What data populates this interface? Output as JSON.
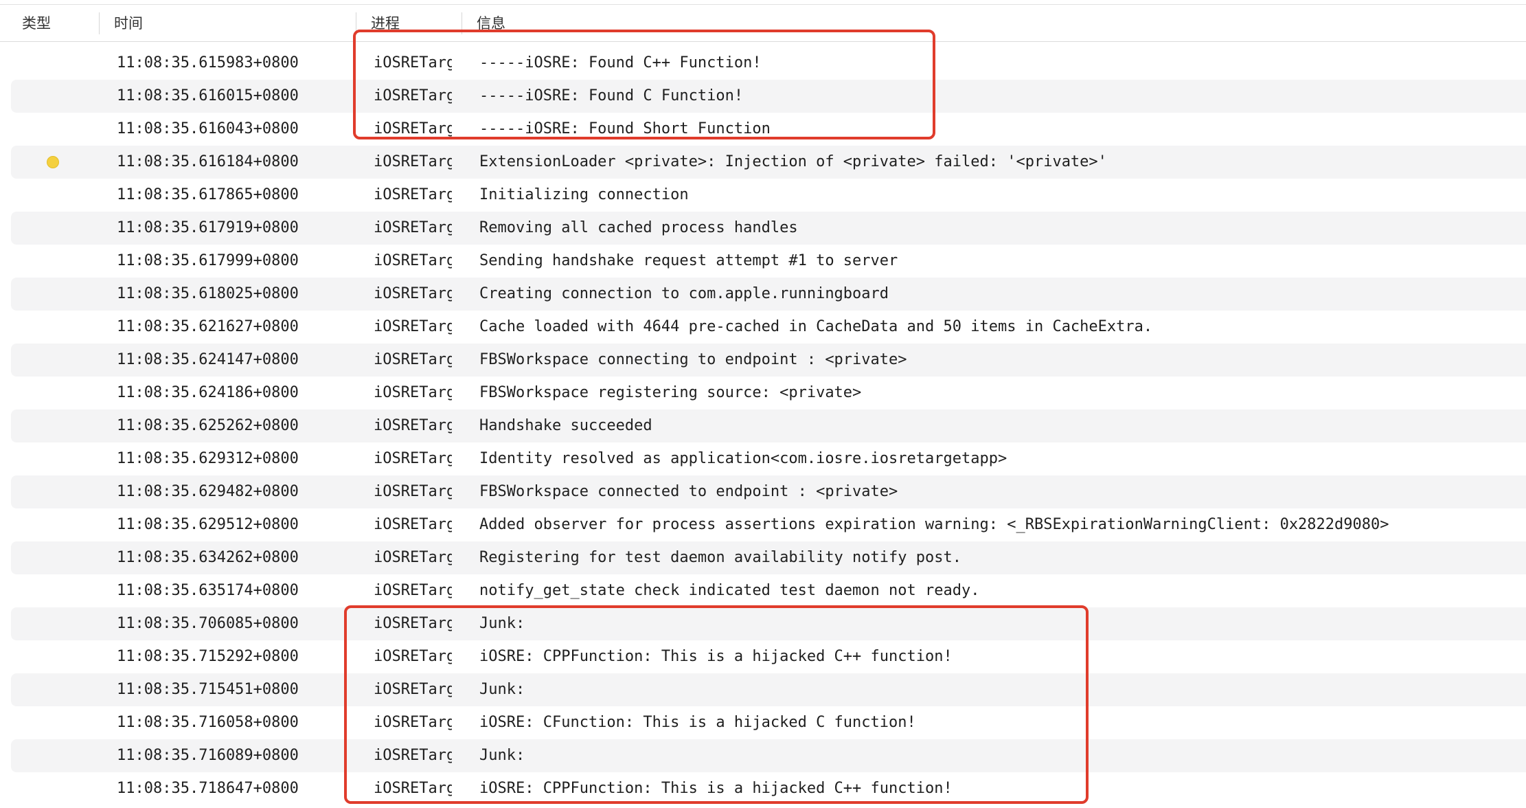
{
  "columns": {
    "type": "类型",
    "time": "时间",
    "process": "进程",
    "message": "信息"
  },
  "rows": [
    {
      "type": "",
      "time": "11:08:35.615983+0800",
      "process": "iOSRETargetApp",
      "message": "-----iOSRE: Found C++ Function!"
    },
    {
      "type": "",
      "time": "11:08:35.616015+0800",
      "process": "iOSRETargetApp",
      "message": "-----iOSRE: Found C Function!"
    },
    {
      "type": "",
      "time": "11:08:35.616043+0800",
      "process": "iOSRETargetApp",
      "message": "-----iOSRE: Found Short Function"
    },
    {
      "type": "warning-dot",
      "time": "11:08:35.616184+0800",
      "process": "iOSRETargetApp",
      "message": "ExtensionLoader <private>: Injection of <private> failed: '<private>'"
    },
    {
      "type": "",
      "time": "11:08:35.617865+0800",
      "process": "iOSRETargetApp",
      "message": "Initializing connection"
    },
    {
      "type": "",
      "time": "11:08:35.617919+0800",
      "process": "iOSRETargetApp",
      "message": "Removing all cached process handles"
    },
    {
      "type": "",
      "time": "11:08:35.617999+0800",
      "process": "iOSRETargetApp",
      "message": "Sending handshake request attempt #1 to server"
    },
    {
      "type": "",
      "time": "11:08:35.618025+0800",
      "process": "iOSRETargetApp",
      "message": "Creating connection to com.apple.runningboard"
    },
    {
      "type": "",
      "time": "11:08:35.621627+0800",
      "process": "iOSRETargetApp",
      "message": "Cache loaded with 4644 pre-cached in CacheData and 50 items in CacheExtra."
    },
    {
      "type": "",
      "time": "11:08:35.624147+0800",
      "process": "iOSRETargetApp",
      "message": "FBSWorkspace connecting to endpoint : <private>"
    },
    {
      "type": "",
      "time": "11:08:35.624186+0800",
      "process": "iOSRETargetApp",
      "message": "FBSWorkspace registering source: <private>"
    },
    {
      "type": "",
      "time": "11:08:35.625262+0800",
      "process": "iOSRETargetApp",
      "message": "Handshake succeeded"
    },
    {
      "type": "",
      "time": "11:08:35.629312+0800",
      "process": "iOSRETargetApp",
      "message": "Identity resolved as application<com.iosre.iosretargetapp>"
    },
    {
      "type": "",
      "time": "11:08:35.629482+0800",
      "process": "iOSRETargetApp",
      "message": "FBSWorkspace connected to endpoint : <private>"
    },
    {
      "type": "",
      "time": "11:08:35.629512+0800",
      "process": "iOSRETargetApp",
      "message": "Added observer for process assertions expiration warning: <_RBSExpirationWarningClient: 0x2822d9080>"
    },
    {
      "type": "",
      "time": "11:08:35.634262+0800",
      "process": "iOSRETargetApp",
      "message": "Registering for test daemon availability notify post."
    },
    {
      "type": "",
      "time": "11:08:35.635174+0800",
      "process": "iOSRETargetApp",
      "message": "notify_get_state check indicated test daemon not ready."
    },
    {
      "type": "",
      "time": "11:08:35.706085+0800",
      "process": "iOSRETargetApp",
      "message": "Junk:"
    },
    {
      "type": "",
      "time": "11:08:35.715292+0800",
      "process": "iOSRETargetApp",
      "message": "iOSRE: CPPFunction: This is a hijacked C++ function!"
    },
    {
      "type": "",
      "time": "11:08:35.715451+0800",
      "process": "iOSRETargetApp",
      "message": "Junk:"
    },
    {
      "type": "",
      "time": "11:08:35.716058+0800",
      "process": "iOSRETargetApp",
      "message": "iOSRE: CFunction: This is a hijacked C function!"
    },
    {
      "type": "",
      "time": "11:08:35.716089+0800",
      "process": "iOSRETargetApp",
      "message": "Junk:"
    },
    {
      "type": "",
      "time": "11:08:35.718647+0800",
      "process": "iOSRETargetApp",
      "message": "iOSRE: CPPFunction: This is a hijacked C++ function!"
    }
  ],
  "colors": {
    "highlight": "#e03c2c",
    "warning_dot": "#f4d03f",
    "alt_row": "#f4f4f5"
  }
}
